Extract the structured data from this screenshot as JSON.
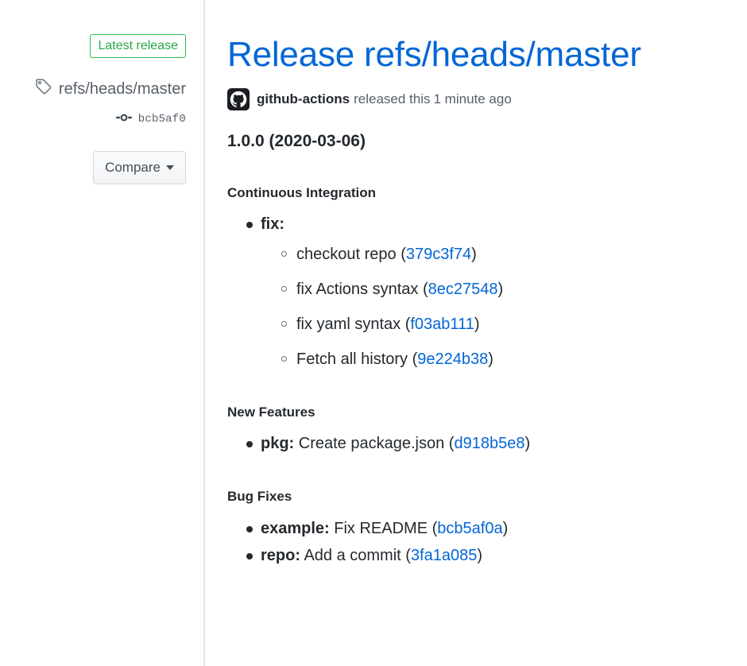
{
  "sidebar": {
    "badge_label": "Latest release",
    "tag_icon": "tag-icon",
    "tag_name": "refs/heads/master",
    "commit_icon": "commit-icon",
    "commit_sha": "bcb5af0",
    "compare_label": "Compare",
    "caret_icon": "chevron-down-icon"
  },
  "header": {
    "title": "Release refs/heads/master",
    "avatar_icon": "github-avatar-icon",
    "author": "github-actions",
    "released_text": "released this",
    "timestamp": "1 minute ago"
  },
  "body": {
    "version_title": "1.0.0 (2020-03-06)",
    "sections": [
      {
        "heading": "Continuous Integration",
        "items": [
          {
            "scope": "fix:",
            "text": "",
            "sha": "",
            "children": [
              {
                "text": "checkout repo",
                "sha": "379c3f74"
              },
              {
                "text": "fix Actions syntax",
                "sha": "8ec27548"
              },
              {
                "text": "fix yaml syntax",
                "sha": "f03ab111"
              },
              {
                "text": "Fetch all history",
                "sha": "9e224b38"
              }
            ]
          }
        ]
      },
      {
        "heading": "New Features",
        "items": [
          {
            "scope": "pkg:",
            "text": "Create package.json",
            "sha": "d918b5e8",
            "children": []
          }
        ]
      },
      {
        "heading": "Bug Fixes",
        "items": [
          {
            "scope": "example:",
            "text": "Fix README",
            "sha": "bcb5af0a",
            "children": []
          },
          {
            "scope": "repo:",
            "text": "Add a commit",
            "sha": "3fa1a085",
            "children": []
          }
        ]
      }
    ]
  },
  "colors": {
    "link": "#0366d6",
    "badge_green": "#28a745",
    "badge_border": "#2cbe4e",
    "muted": "#586069",
    "text": "#24292e",
    "divider": "#e1e4e8"
  }
}
